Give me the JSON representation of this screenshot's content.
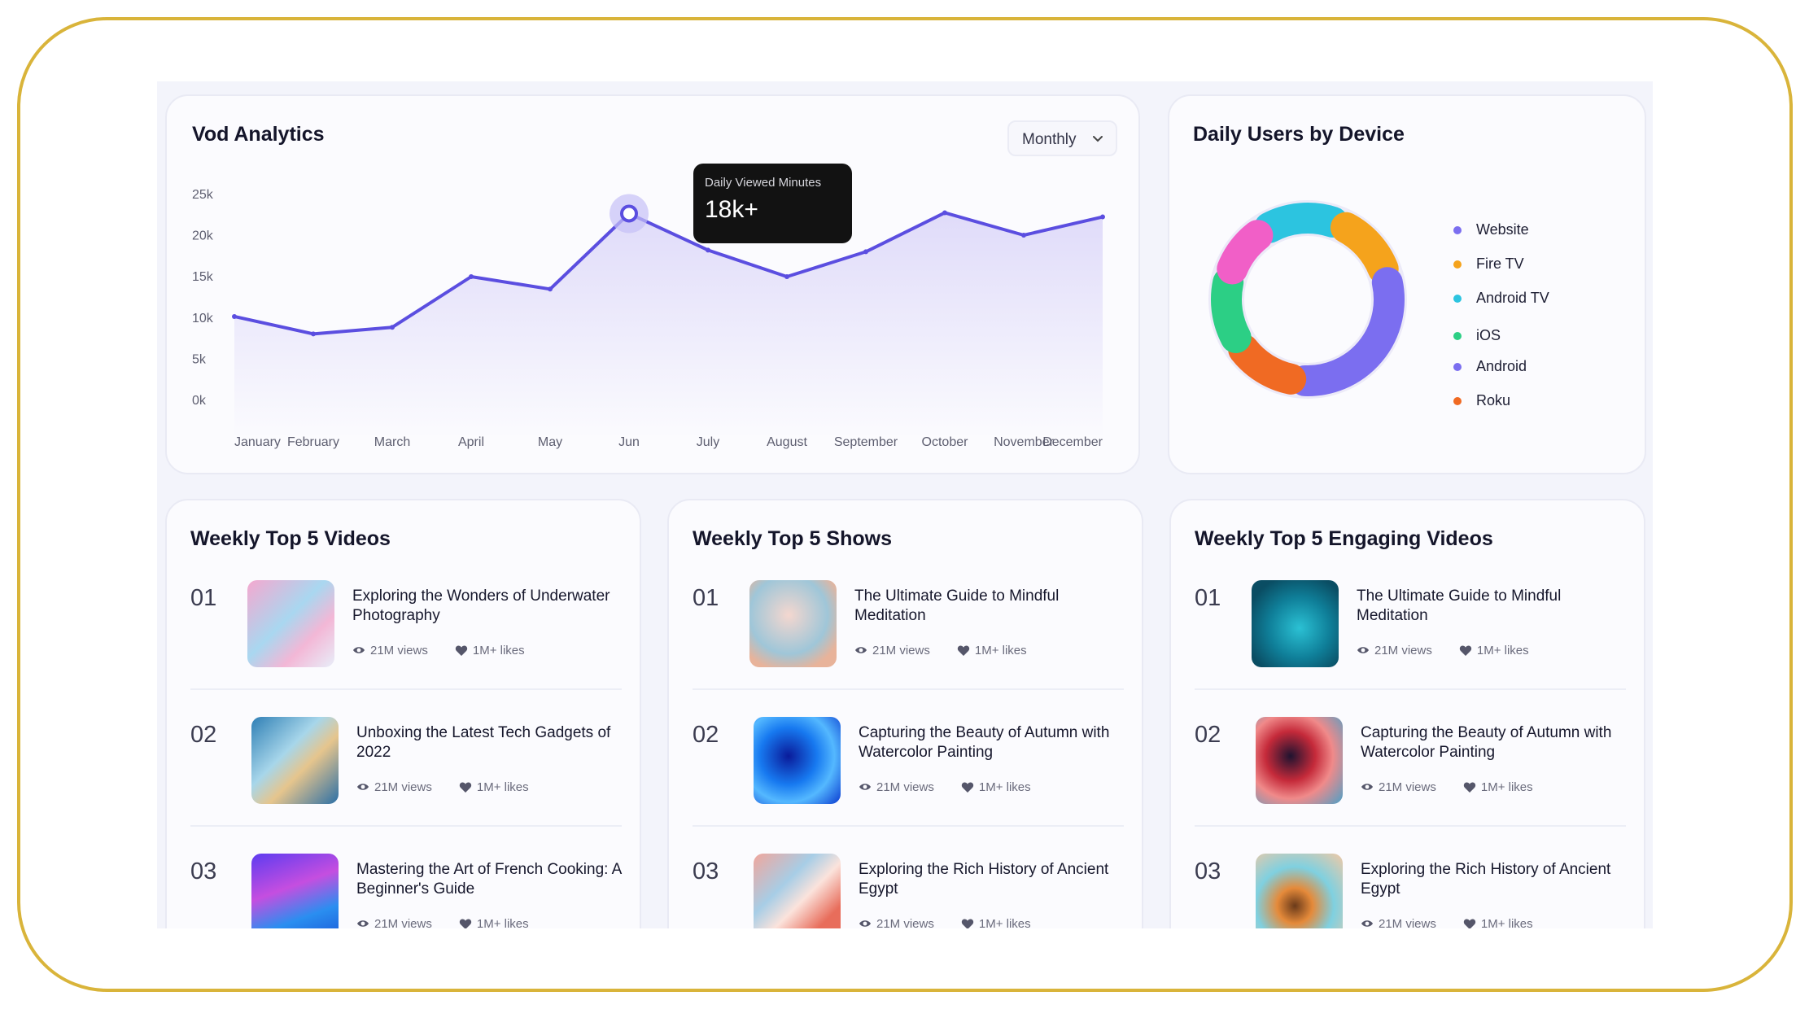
{
  "analytics": {
    "title": "Vod Analytics",
    "period": "Monthly",
    "tooltip_label": "Daily Viewed Minutes",
    "tooltip_value": "18k+",
    "chart_data": {
      "type": "area",
      "title": "",
      "xlabel": "",
      "ylabel": "",
      "categories": [
        "January",
        "February",
        "March",
        "April",
        "May",
        "Jun",
        "July",
        "August",
        "September",
        "October",
        "November",
        "December"
      ],
      "y_ticks": [
        "25k",
        "20k",
        "15k",
        "10k",
        "5k",
        "0k"
      ],
      "ylim": [
        0,
        25000
      ],
      "grid": false,
      "series": [
        {
          "values": [
            10200,
            8100,
            8900,
            15000,
            13500,
            22600,
            18200,
            15000,
            18000,
            22700,
            20000,
            22200
          ]
        }
      ],
      "highlight_index": 5,
      "line_color": "#5b4ee0",
      "fill_color": "#c9c1f5"
    }
  },
  "devices": {
    "title": "Daily Users by Device",
    "legend": [
      {
        "label": "Website",
        "color": "#7b6ef0"
      },
      {
        "label": "Fire TV",
        "color": "#f5a31c"
      },
      {
        "label": "Android TV",
        "color": "#2cc4e0"
      },
      {
        "label": "iOS",
        "color": "#2ccf85"
      },
      {
        "label": "Android",
        "color": "#7b6ef0"
      },
      {
        "label": "Roku",
        "color": "#f06a23"
      }
    ]
  },
  "lists": [
    {
      "title": "Weekly Top 5 Videos",
      "items": [
        {
          "rank": "01",
          "title": "Exploring the Wonders of Underwater Photography",
          "views": "21M views",
          "likes": "1M+ likes"
        },
        {
          "rank": "02",
          "title": "Unboxing the Latest Tech Gadgets of 2022",
          "views": "21M views",
          "likes": "1M+ likes"
        },
        {
          "rank": "03",
          "title": "Mastering the Art of French Cooking: A Beginner's Guide",
          "views": "21M views",
          "likes": "1M+ likes"
        }
      ]
    },
    {
      "title": "Weekly Top 5 Shows",
      "items": [
        {
          "rank": "01",
          "title": "The Ultimate Guide to Mindful Meditation",
          "views": "21M views",
          "likes": "1M+ likes"
        },
        {
          "rank": "02",
          "title": "Capturing the Beauty of Autumn with Watercolor Painting",
          "views": "21M views",
          "likes": "1M+ likes"
        },
        {
          "rank": "03",
          "title": "Exploring the Rich History of Ancient Egypt",
          "views": "21M views",
          "likes": "1M+ likes"
        }
      ]
    },
    {
      "title": "Weekly Top 5 Engaging Videos",
      "items": [
        {
          "rank": "01",
          "title": "The Ultimate Guide to Mindful Meditation",
          "views": "21M views",
          "likes": "1M+ likes"
        },
        {
          "rank": "02",
          "title": "Capturing the Beauty of Autumn with Watercolor Painting",
          "views": "21M views",
          "likes": "1M+ likes"
        },
        {
          "rank": "03",
          "title": "Exploring the Rich History of Ancient Egypt",
          "views": "21M views",
          "likes": "1M+ likes"
        }
      ]
    }
  ]
}
